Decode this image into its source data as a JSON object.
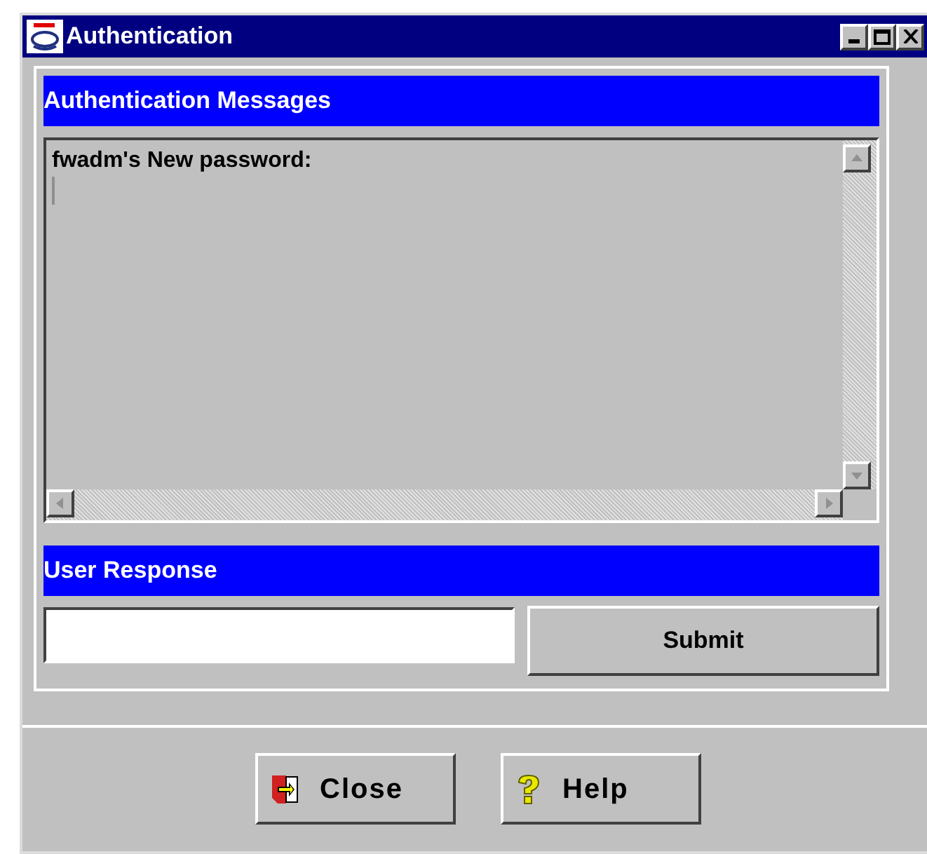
{
  "window": {
    "title": "Authentication"
  },
  "messages": {
    "header": "Authentication Messages",
    "text": "fwadm's New password:"
  },
  "response": {
    "header": "User Response",
    "submit": "Submit"
  },
  "buttons": [
    {
      "label": "Close",
      "kind": "close"
    },
    {
      "label": "Help",
      "kind": "help"
    }
  ]
}
